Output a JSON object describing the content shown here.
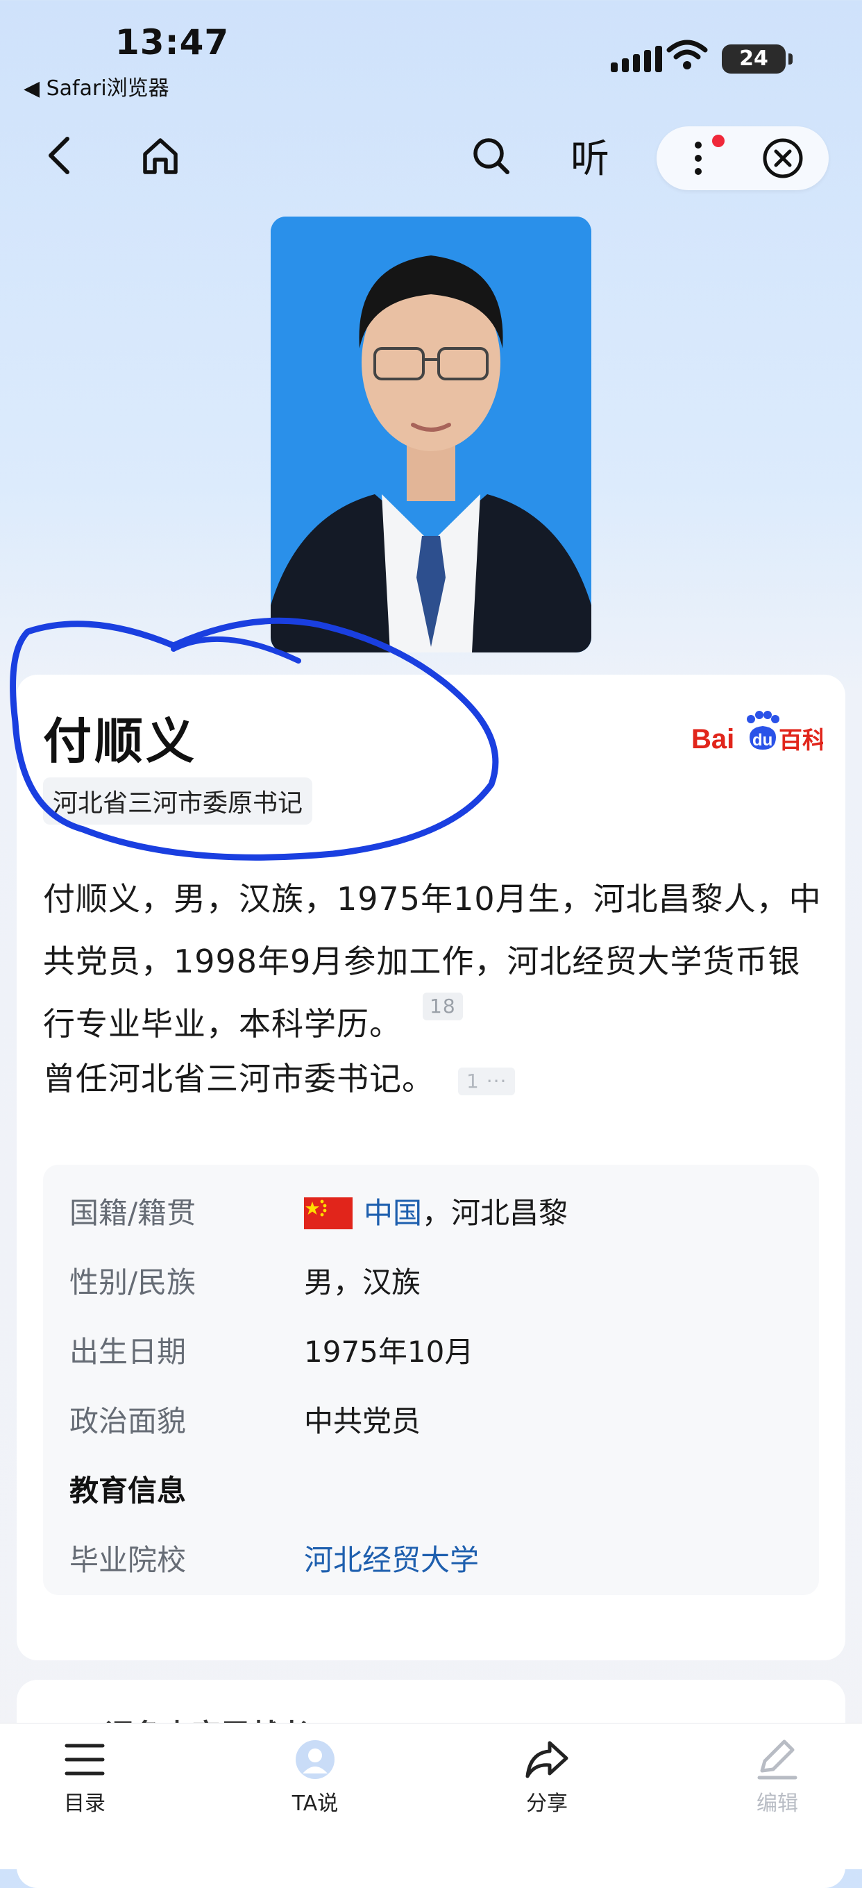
{
  "status_bar": {
    "time": "13:47",
    "back_app": "◀ Safari浏览器",
    "battery": "24"
  },
  "nav": {
    "listen": "听"
  },
  "person": {
    "name": "付顺义",
    "tag": "河北省三河市委原书记",
    "summary": "付顺义，男，汉族，1975年10月生，河北昌黎人，中共党员，1998年9月参加工作，河北经贸大学货币银行专业毕业，本科学历。",
    "summary_ref": "18",
    "summary2": "曾任河北省三河市委书记。",
    "summary2_ref": "1 ···"
  },
  "logo": {
    "text_bai": "Bai",
    "text_du": "du",
    "text_baike": "百科"
  },
  "info": {
    "nationality_label": "国籍/籍贯",
    "nationality_country": "中国",
    "nationality_rest": "，河北昌黎",
    "gender_label": "性别/民族",
    "gender_value": "男，汉族",
    "birth_label": "出生日期",
    "birth_value": "1975年10月",
    "party_label": "政治面貌",
    "party_value": "中共党员",
    "education_section": "教育信息",
    "school_label": "毕业院校",
    "school_value": "河北经贸大学"
  },
  "next_card_title": "词条内容贡献者",
  "tabbar": [
    {
      "label": "目录"
    },
    {
      "label": "TA说"
    },
    {
      "label": "分享"
    },
    {
      "label": "编辑"
    }
  ],
  "colors": {
    "link": "#1e5fae",
    "annotation": "#1a3fe0",
    "baike_red": "#e1251b"
  }
}
